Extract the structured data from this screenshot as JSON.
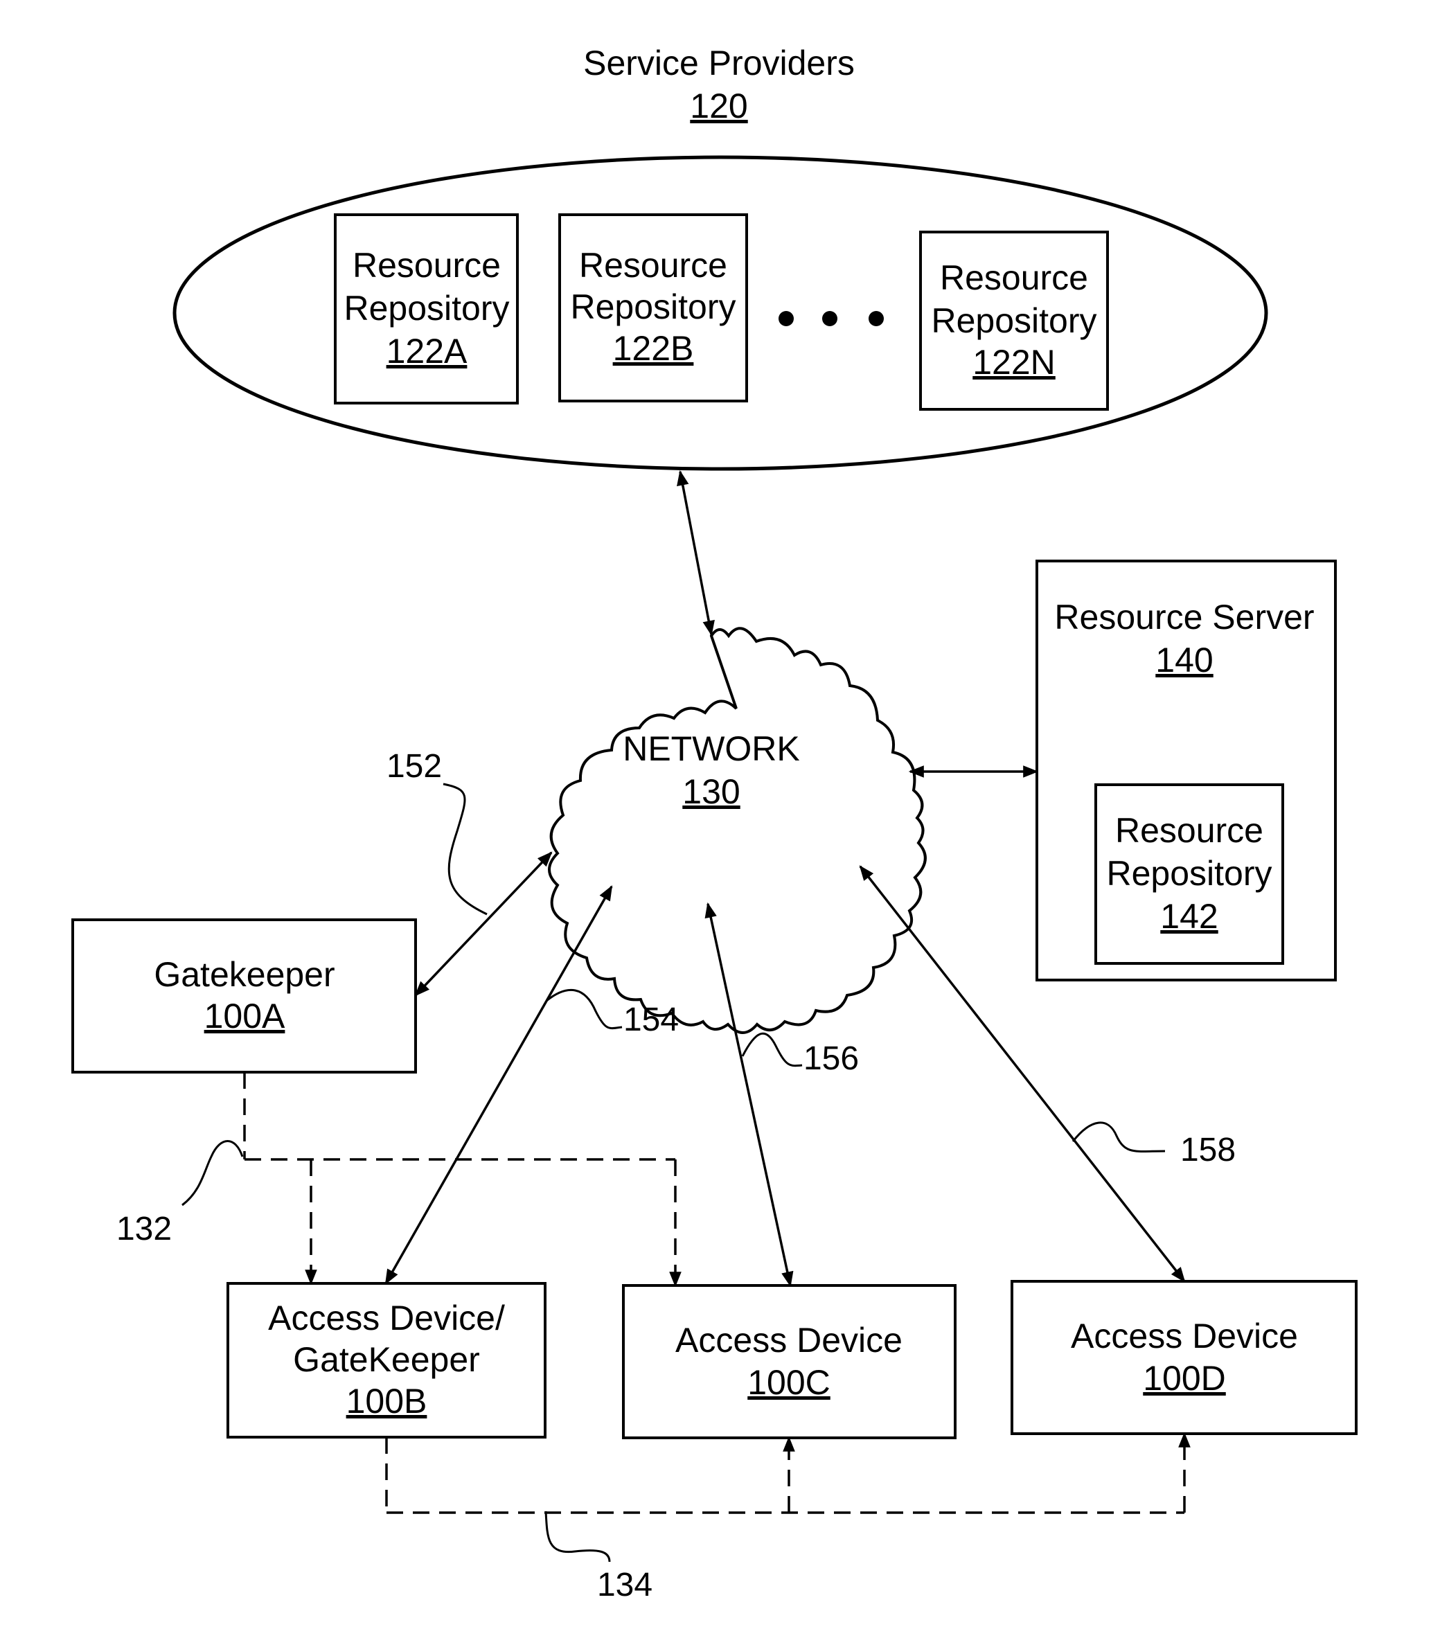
{
  "diagram": {
    "service_providers": {
      "title": "Service Providers",
      "ref": "120"
    },
    "repositories": [
      {
        "title_line1": "Resource",
        "title_line2": "Repository",
        "ref": "122A"
      },
      {
        "title_line1": "Resource",
        "title_line2": "Repository",
        "ref": "122B"
      },
      {
        "title_line1": "Resource",
        "title_line2": "Repository",
        "ref": "122N"
      }
    ],
    "ellipsis": "• • •",
    "network": {
      "title": "NETWORK",
      "ref": "130"
    },
    "resource_server": {
      "title": "Resource Server",
      "ref": "140",
      "repository": {
        "title_line1": "Resource",
        "title_line2": "Repository",
        "ref": "142"
      }
    },
    "gatekeeper": {
      "title": "Gatekeeper",
      "ref": "100A"
    },
    "access_devices": [
      {
        "title_line1": "Access Device/",
        "title_line2": "GateKeeper",
        "ref": "100B"
      },
      {
        "title_line1": "Access Device",
        "ref": "100C"
      },
      {
        "title_line1": "Access Device",
        "ref": "100D"
      }
    ],
    "connection_labels": {
      "c132": "132",
      "c134": "134",
      "c152": "152",
      "c154": "154",
      "c156": "156",
      "c158": "158"
    },
    "line_color": "#000000",
    "background": "#ffffff"
  }
}
